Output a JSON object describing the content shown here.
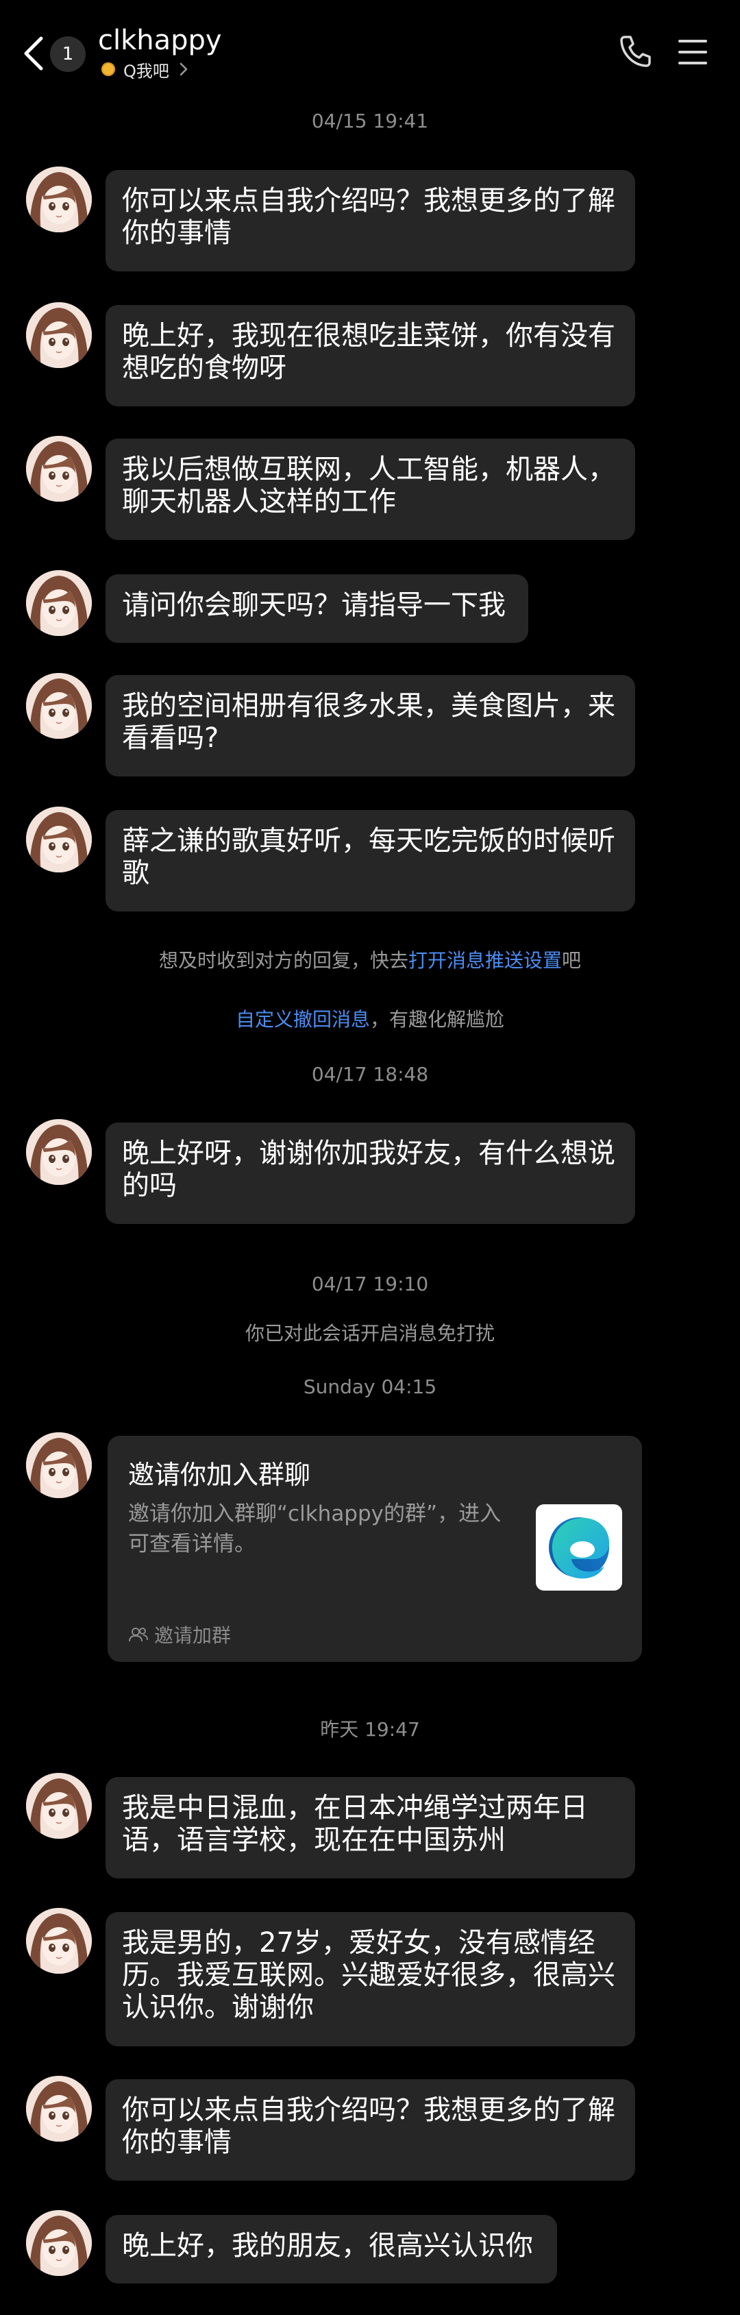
{
  "header": {
    "unread_count": "1",
    "title": "clkhappy",
    "subtitle": "Q我吧"
  },
  "messages": [
    {
      "type": "timestamp",
      "text": "04/15 19:41"
    },
    {
      "type": "bubble",
      "text": "你可以来点自我介绍吗？我想更多的了解你的事情"
    },
    {
      "type": "bubble",
      "text": "晚上好，我现在很想吃韭菜饼，你有没有想吃的食物呀"
    },
    {
      "type": "bubble",
      "text": "我以后想做互联网，人工智能，机器人，聊天机器人这样的工作"
    },
    {
      "type": "bubble",
      "text": "请问你会聊天吗？请指导一下我"
    },
    {
      "type": "bubble",
      "text": "我的空间相册有很多水果，美食图片，来看看吗?"
    },
    {
      "type": "bubble",
      "text": "薛之谦的歌真好听，每天吃完饭的时候听歌"
    }
  ],
  "system_notice_1": {
    "before": "想及时收到对方的回复，快去",
    "link": "打开消息推送设置",
    "after": "吧"
  },
  "system_notice_2": {
    "link": "自定义撤回消息",
    "after": "，有趣化解尴尬"
  },
  "messages_2": [
    {
      "type": "timestamp",
      "text": "04/17 18:48"
    },
    {
      "type": "bubble",
      "text": "晚上好呀，谢谢你加我好友，有什么想说的吗"
    },
    {
      "type": "timestamp",
      "text": "04/17 19:10"
    },
    {
      "type": "system",
      "text": "你已对此会话开启消息免打扰"
    },
    {
      "type": "timestamp",
      "text": "Sunday 04:15"
    }
  ],
  "invite_card": {
    "title": "邀请你加入群聊",
    "description": "邀请你加入群聊“clkhappy的群”，进入可查看详情。",
    "footer": "邀请加群"
  },
  "messages_3": [
    {
      "type": "timestamp",
      "text": "昨天 19:47"
    },
    {
      "type": "bubble",
      "text": "我是中日混血，在日本冲绳学过两年日语，语言学校，现在在中国苏州"
    },
    {
      "type": "bubble",
      "text": "我是男的，27岁，爱好女，没有感情经历。我爱互联网。兴趣爱好很多，很高兴认识你。谢谢你"
    },
    {
      "type": "bubble",
      "text": "你可以来点自我介绍吗？我想更多的了解你的事情"
    },
    {
      "type": "bubble",
      "text": "晚上好，我的朋友，很高兴认识你"
    }
  ],
  "colors": {
    "background": "#000000",
    "bubble": "#262626",
    "link": "#4b8df2",
    "status_dot": "#f2b635"
  }
}
